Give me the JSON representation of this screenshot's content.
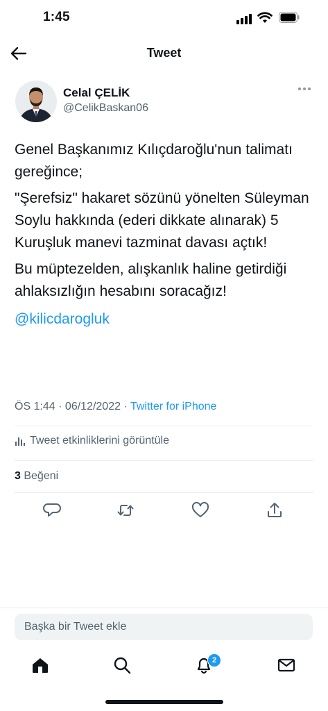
{
  "status_bar": {
    "time": "1:45"
  },
  "nav": {
    "title": "Tweet"
  },
  "author": {
    "name": "Celal ÇELİK",
    "handle": "@CelikBaskan06"
  },
  "tweet": {
    "paragraphs": [
      "Genel Başkanımız Kılıçdaroğlu'nun talimatı gereğince;",
      "\"Şerefsiz\" hakaret sözünü yönelten Süleyman Soylu hakkında (ederi dikkate alınarak) 5 Kuruşluk manevi tazminat davası açtık!",
      "Bu müptezelden, alışkanlık haline getirdiği ahlaksızlığın hesabını soracağız!"
    ],
    "mention": "@kilicdarogluk",
    "time": "ÖS 1:44",
    "date": "06/12/2022",
    "source": "Twitter for iPhone",
    "sep": " · ",
    "activity_label": "Tweet etkinliklerini görüntüle",
    "likes_count": "3",
    "likes_label": " Beğeni"
  },
  "reply": {
    "placeholder": "Başka bir Tweet ekle"
  },
  "tab_bar": {
    "notifications_badge": "2"
  },
  "icons": {
    "back": "arrow-left-icon",
    "more": "more-horizontal-icon",
    "reply": "reply-icon",
    "retweet": "retweet-icon",
    "like": "heart-icon",
    "share": "share-icon",
    "home": "home-icon",
    "search": "search-icon",
    "notifications": "bell-icon",
    "messages": "mail-icon"
  },
  "colors": {
    "accent": "#1d9bf0",
    "text": "#0f1419",
    "secondary": "#536471"
  }
}
